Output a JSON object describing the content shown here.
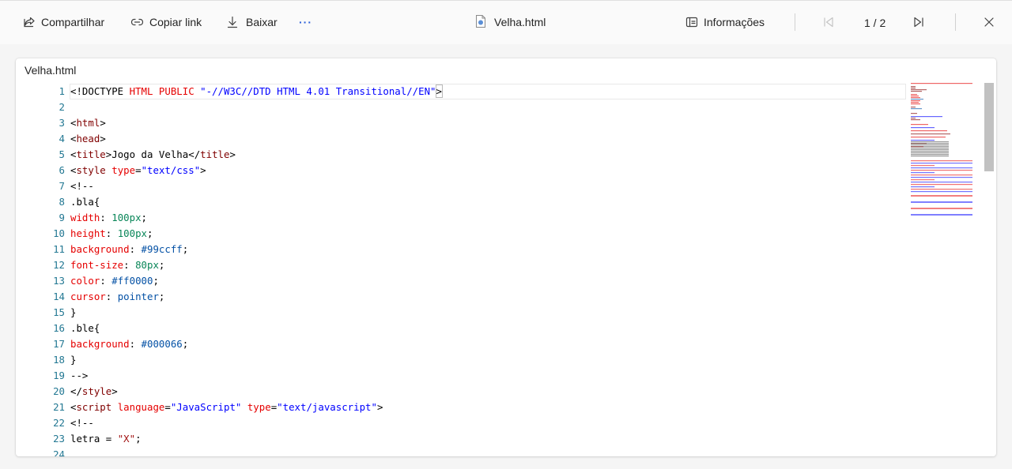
{
  "toolbar": {
    "share_label": "Compartilhar",
    "copy_link_label": "Copiar link",
    "download_label": "Baixar",
    "more_label": "···",
    "file_name": "Velha.html",
    "info_label": "Informações",
    "page_indicator": "1 / 2"
  },
  "panel": {
    "title": "Velha.html"
  },
  "code_lines": [
    "<!DOCTYPE HTML PUBLIC \"-//W3C//DTD HTML 4.01 Transitional//EN\">",
    "",
    "<html>",
    "<head>",
    "<title>Jogo da Velha</title>",
    "<style type=\"text/css\">",
    "<!--",
    ".bla{",
    "width: 100px;",
    "height: 100px;",
    "background: #99ccff;",
    "font-size: 80px;",
    "color: #ff0000;",
    "cursor: pointer;",
    "}",
    ".ble{",
    "background: #000066;",
    "}",
    "-->",
    "</style>",
    "<script language=\"JavaScript\" type=\"text/javascript\">",
    "<!--",
    "letra = \"X\";",
    ""
  ],
  "colors": {
    "tag": "#800000",
    "attr": "#e50000",
    "string": "#0000ff",
    "number": "#098658",
    "value": "#0451a5",
    "line_number": "#237893"
  }
}
